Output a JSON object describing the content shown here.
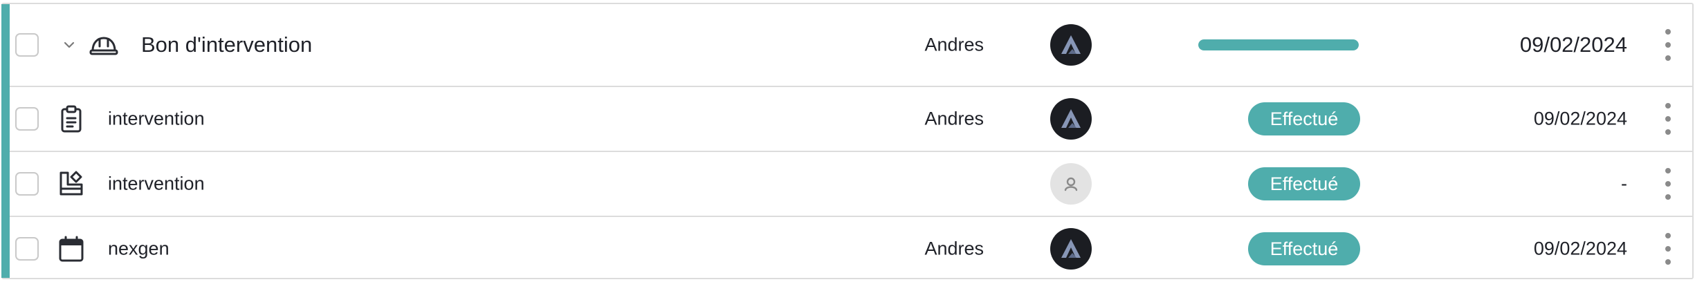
{
  "colors": {
    "accent": "#4fadac",
    "border": "#dcdcdc",
    "text": "#1f2128",
    "avatar_bg": "#1b1d22",
    "avatar_logo": "#8796b6"
  },
  "parent": {
    "icon": "hard-hat-icon",
    "title": "Bon d'intervention",
    "assignee": "Andres",
    "progress": 1.0,
    "date": "09/02/2024"
  },
  "children": [
    {
      "icon": "clipboard-icon",
      "title": "intervention",
      "assignee": "Andres",
      "status": "Effectué",
      "date": "09/02/2024"
    },
    {
      "icon": "shapes-icon",
      "title": "intervention",
      "assignee": "",
      "status": "Effectué",
      "date": "-"
    },
    {
      "icon": "calendar-icon",
      "title": "nexgen",
      "assignee": "Andres",
      "status": "Effectué",
      "date": "09/02/2024"
    }
  ]
}
